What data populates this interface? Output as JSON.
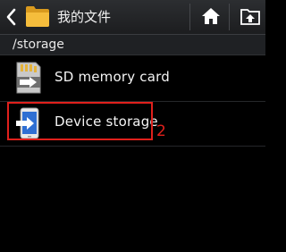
{
  "action_bar": {
    "title": "我的文件",
    "back_icon": "chevron-left-icon",
    "folder_icon": "folder-icon",
    "home_icon": "home-icon",
    "up_icon": "folder-up-icon"
  },
  "path": {
    "current": "/storage"
  },
  "items": [
    {
      "label": "SD memory card",
      "icon": "sd-card-icon"
    },
    {
      "label": "Device storage",
      "icon": "phone-storage-icon"
    }
  ],
  "annotation": {
    "number": "2",
    "color": "#e0201c"
  },
  "colors": {
    "background": "#000000",
    "folder": "#f2b632",
    "device_blue": "#2f6fd3"
  }
}
